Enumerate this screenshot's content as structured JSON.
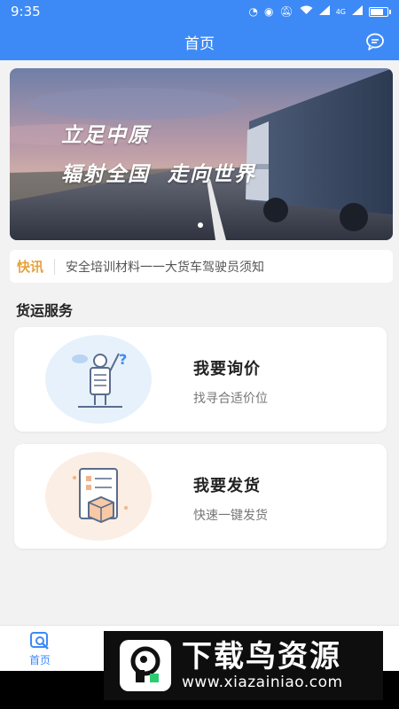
{
  "status_bar": {
    "time": "9:35",
    "icons": [
      "speed-icon",
      "eye-icon",
      "mute-icon",
      "wifi-icon",
      "signal-icon",
      "signal-icon",
      "battery-icon"
    ],
    "signal_label": "4G"
  },
  "nav": {
    "title": "首页",
    "right_icon": "chat-icon"
  },
  "banner": {
    "line1": "立足中原",
    "line2": "辐射全国  走向世界",
    "page_indicator": {
      "count": 1,
      "active": 0
    }
  },
  "news": {
    "tag": "快讯",
    "text": "安全培训材料一一大货车驾驶员须知"
  },
  "section": {
    "title": "货运服务"
  },
  "cards": [
    {
      "title": "我要询价",
      "subtitle": "找寻合适价位",
      "icon": "inquiry-illustration"
    },
    {
      "title": "我要发货",
      "subtitle": "快速一键发货",
      "icon": "shipping-illustration"
    }
  ],
  "tab_bar": {
    "home_label": "首页",
    "home_icon": "home-search-icon"
  },
  "watermark": {
    "title": "下载鸟资源",
    "url": "www.xiazainiao.com"
  },
  "colors": {
    "primary": "#3d8af7",
    "news_tag": "#e6a23c",
    "background": "#f2f2f2"
  }
}
